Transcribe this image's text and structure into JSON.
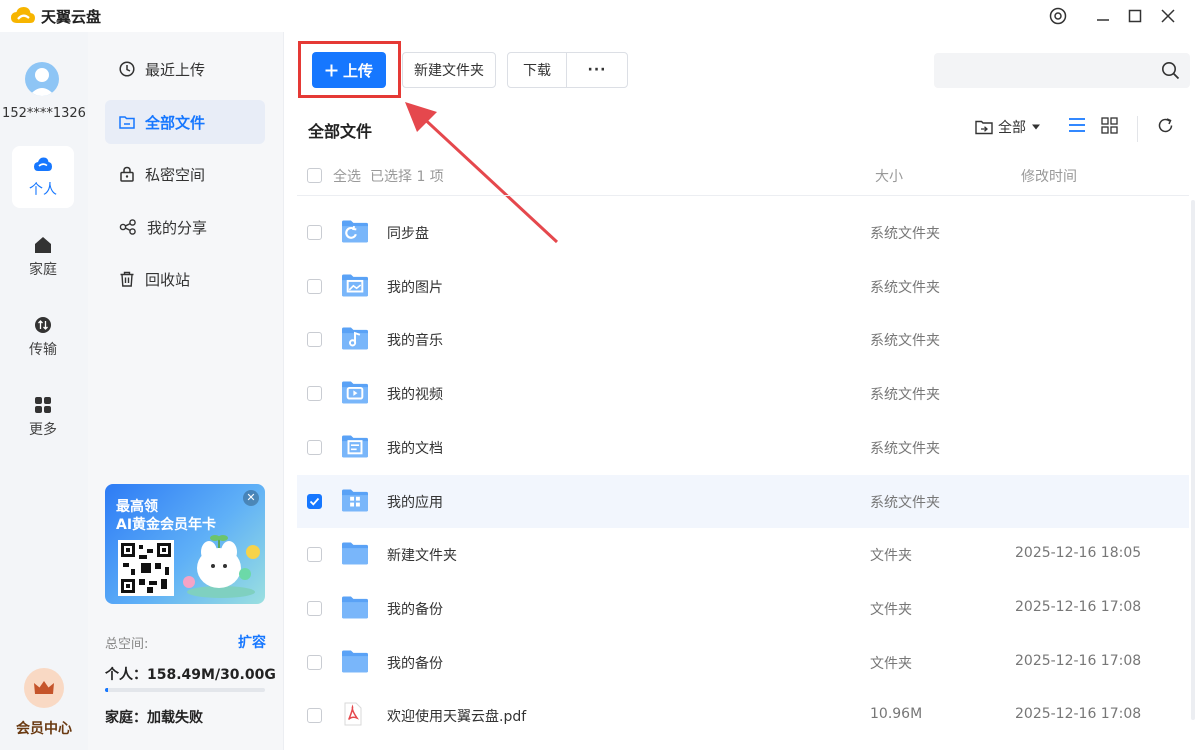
{
  "app": {
    "title": "天翼云盘",
    "brand_color": "#1677ff"
  },
  "user": {
    "phone": "152****1326"
  },
  "leftnav": [
    {
      "label": "个人",
      "icon": "cloud-icon",
      "active": true
    },
    {
      "label": "家庭",
      "icon": "home-icon",
      "active": false
    },
    {
      "label": "传输",
      "icon": "transfer-icon",
      "active": false
    },
    {
      "label": "更多",
      "icon": "grid-icon",
      "active": false
    }
  ],
  "member": {
    "label": "会员中心"
  },
  "sidebar": {
    "items": [
      {
        "label": "最近上传",
        "icon": "clock-icon"
      },
      {
        "label": "全部文件",
        "icon": "folder-icon",
        "active": true
      },
      {
        "label": "私密空间",
        "icon": "lock-icon"
      },
      {
        "label": "我的分享",
        "icon": "share-icon"
      },
      {
        "label": "回收站",
        "icon": "trash-icon"
      }
    ],
    "promo": {
      "line1": "最高领",
      "line2": "AI黄金会员年卡"
    },
    "storage": {
      "total_label": "总空间:",
      "expand": "扩容",
      "personal": "个人：158.49M/30.00G",
      "personal_used_fraction": 0.005,
      "family": "家庭：加载失败"
    }
  },
  "toolbar": {
    "upload": "上传",
    "new_folder": "新建文件夹",
    "download": "下载",
    "more": "···"
  },
  "main": {
    "title": "全部文件",
    "filter": "全部",
    "header": {
      "select_all": "全选",
      "selected": "已选择 1 项",
      "size": "大小",
      "modified": "修改时间"
    },
    "files": [
      {
        "name": "同步盘",
        "size": "系统文件夹",
        "time": "",
        "checked": false,
        "glyph": "sync"
      },
      {
        "name": "我的图片",
        "size": "系统文件夹",
        "time": "",
        "checked": false,
        "glyph": "image"
      },
      {
        "name": "我的音乐",
        "size": "系统文件夹",
        "time": "",
        "checked": false,
        "glyph": "music"
      },
      {
        "name": "我的视频",
        "size": "系统文件夹",
        "time": "",
        "checked": false,
        "glyph": "video"
      },
      {
        "name": "我的文档",
        "size": "系统文件夹",
        "time": "",
        "checked": false,
        "glyph": "doc"
      },
      {
        "name": "我的应用",
        "size": "系统文件夹",
        "time": "",
        "checked": true,
        "glyph": "apps"
      },
      {
        "name": "新建文件夹",
        "size": "文件夹",
        "time": "2025-12-16 18:05",
        "checked": false,
        "glyph": ""
      },
      {
        "name": "我的备份",
        "size": "文件夹",
        "time": "2025-12-16 17:08",
        "checked": false,
        "glyph": ""
      },
      {
        "name": "我的备份",
        "size": "文件夹",
        "time": "2025-12-16 17:08",
        "checked": false,
        "glyph": ""
      },
      {
        "name": "欢迎使用天翼云盘.pdf",
        "size": "10.96M",
        "time": "2025-12-16 17:08",
        "checked": false,
        "glyph": "pdf"
      }
    ]
  }
}
